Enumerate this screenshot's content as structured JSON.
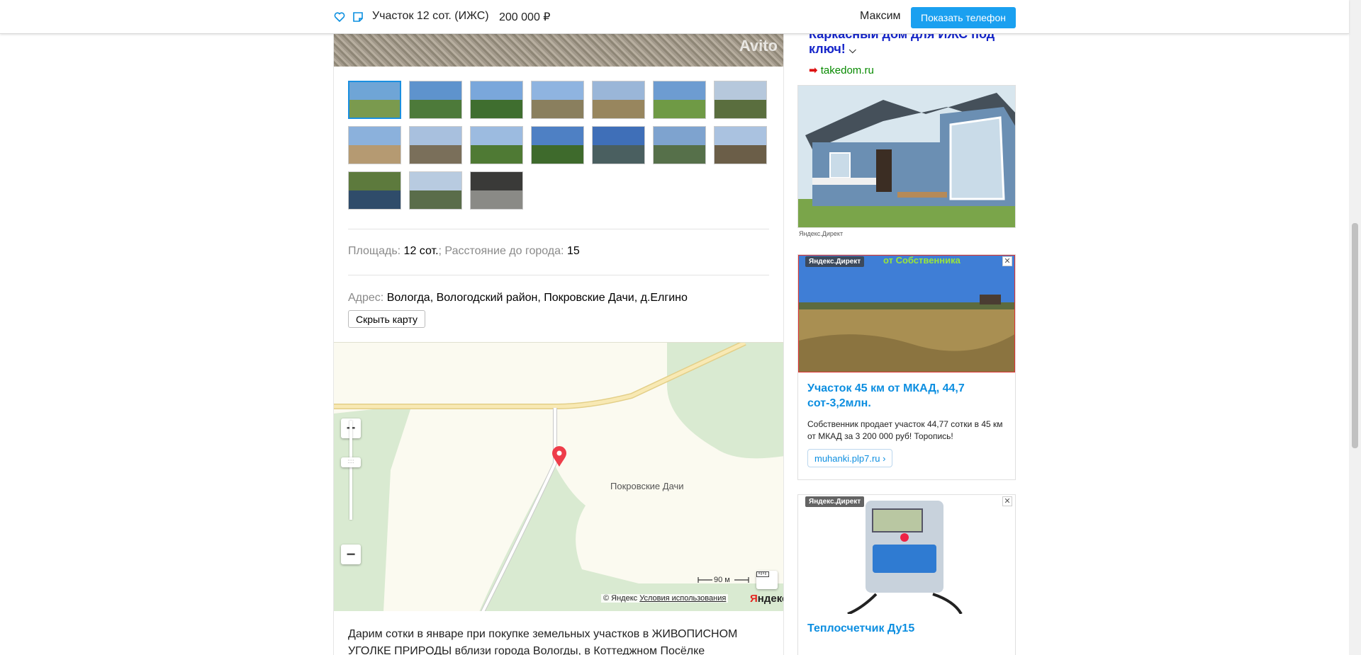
{
  "header": {
    "title": "Участок 12 сот. (ИЖС)",
    "price": "200 000  ₽",
    "seller": "Максим",
    "phone_button": "Показать телефон"
  },
  "gallery": {
    "watermark": "Avito",
    "thumbnails": 17,
    "selected_index": 0
  },
  "params": {
    "area_label": "Площадь:",
    "area_value": "12 сот.",
    "sep": ";",
    "distance_label": "Расстояние до города:",
    "distance_value": "15"
  },
  "address": {
    "label": "Адрес:",
    "value": "Вологда, Вологодский район, Покровские Дачи, д.Елгино",
    "hide_map_button": "Скрыть карту"
  },
  "map": {
    "place_label": "Покровские Дачи",
    "scale": "90 м",
    "copyright": "© Яндекс",
    "terms_link": "Условия использования",
    "logo_a": "Я",
    "logo_b": "ндекс",
    "zoom_in": "+",
    "zoom_out": "−"
  },
  "description": "Дарим сотки в январе при покупке земельных участков в ЖИВОПИСНОМ УГОЛКЕ ПРИРОДЫ вблизи города Вологды, в Коттеджном Посёлке",
  "ads": {
    "ad1": {
      "title": "Каркасный дом для ИЖС под ключ!",
      "domain": "takedom.ru",
      "source": "Яндекс.Директ"
    },
    "ad2": {
      "badge": "Яндекс.Директ",
      "topline": "от Собственника",
      "title": "Участок 45 км от МКАД, 44,7 сот-3,2млн.",
      "text": "Собственник продает участок 44,77 сотки в 45 км от МКАД за 3 200 000 руб! Торопись!",
      "link": "muhanki.plp7.ru ›"
    },
    "ad3": {
      "badge": "Яндекс.Директ",
      "title": "Теплосчетчик Ду15"
    }
  }
}
